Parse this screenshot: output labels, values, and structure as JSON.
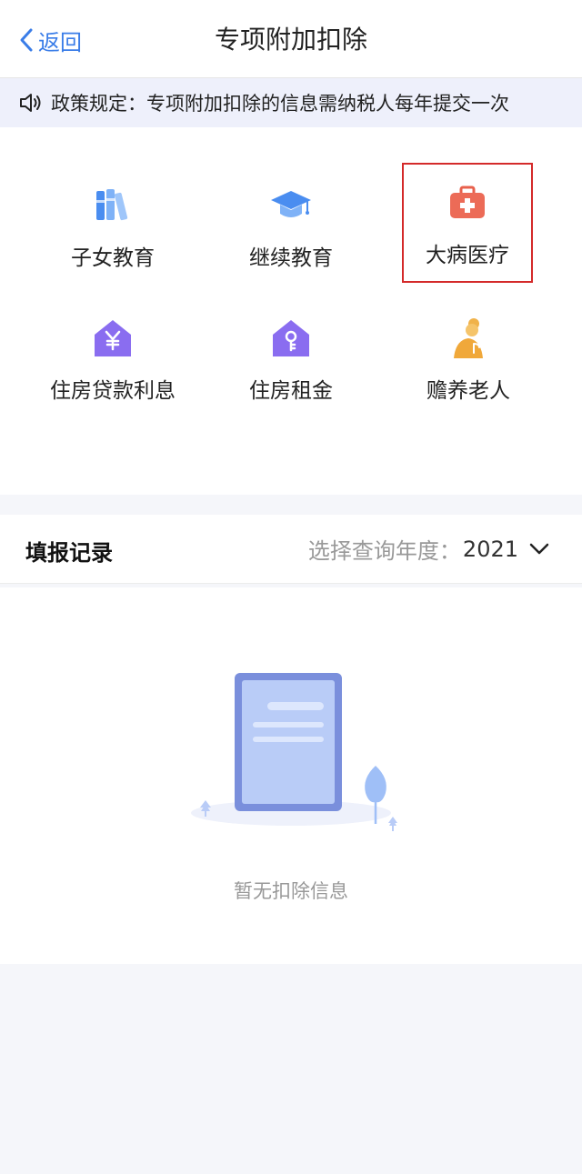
{
  "nav": {
    "back_label": "返回",
    "title": "专项附加扣除"
  },
  "notice": {
    "text": "政策规定：专项附加扣除的信息需纳税人每年提交一次"
  },
  "categories": [
    {
      "label": "子女教育",
      "icon": "books-icon"
    },
    {
      "label": "继续教育",
      "icon": "graduation-cap-icon"
    },
    {
      "label": "大病医疗",
      "icon": "medical-kit-icon",
      "highlighted": true
    },
    {
      "label": "住房贷款利息",
      "icon": "house-yen-icon"
    },
    {
      "label": "住房租金",
      "icon": "house-key-icon"
    },
    {
      "label": "赡养老人",
      "icon": "elderly-person-icon"
    }
  ],
  "records": {
    "title": "填报记录",
    "year_label": "选择查询年度：",
    "year_value": "2021",
    "empty_text": "暂无扣除信息"
  },
  "colors": {
    "accent": "#3a7de8",
    "highlight_border": "#d42a2a",
    "notice_bg": "#eef0fb",
    "page_bg": "#f5f6fa"
  }
}
